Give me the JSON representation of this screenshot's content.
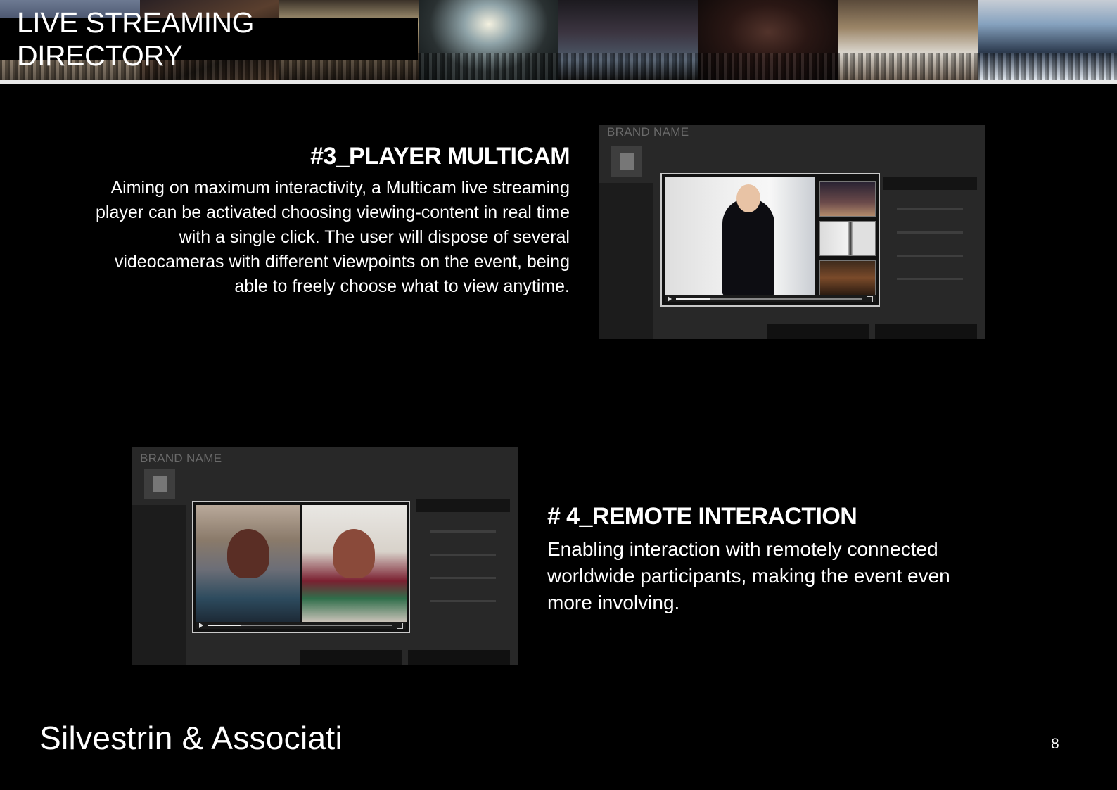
{
  "header": {
    "title": "LIVE STREAMING DIRECTORY"
  },
  "section3": {
    "heading": "#3_PLAYER MULTICAM",
    "body": "Aiming on maximum interactivity, a Multicam live streaming player can be activated choosing viewing-content in real time with a single click. The user will dispose of several videocameras with different viewpoints on the event, being able to freely choose what to view anytime."
  },
  "section4": {
    "heading": "# 4_REMOTE INTERACTION",
    "body": "Enabling interaction with remotely connected worldwide participants, making the event even more involving."
  },
  "screenshots": {
    "multicam_brand": "BRAND NAME",
    "remote_brand": "BRAND NAME"
  },
  "footer": {
    "brand": "Silvestrin & Associati",
    "page_number": "8"
  },
  "colors": {
    "background": "#000000",
    "text": "#ffffff",
    "banner_rule": "#e9e9e9"
  }
}
